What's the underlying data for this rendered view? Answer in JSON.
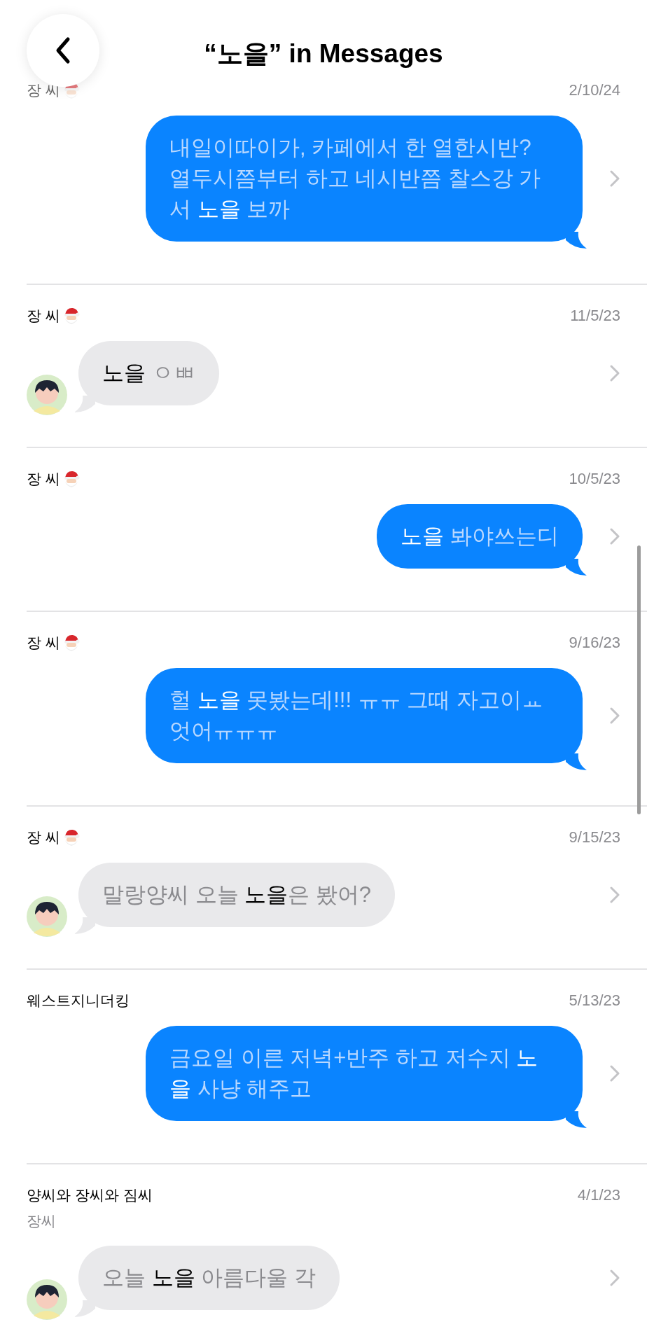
{
  "header": {
    "title": "“노을” in Messages"
  },
  "messages": [
    {
      "sender": "장 씨",
      "badge": true,
      "date": "2/10/24",
      "kind": "outgoing",
      "text": "내일이따이가, 카페에서 한 열한시반? 열두시쯤부터 하고 네시반쯤 찰스강 가서 **노을** 보까"
    },
    {
      "sender": "장 씨",
      "badge": true,
      "date": "11/5/23",
      "kind": "incoming",
      "text": "**노을** ㅇㅃ"
    },
    {
      "sender": "장 씨",
      "badge": true,
      "date": "10/5/23",
      "kind": "outgoing",
      "text": "**노을** 봐야쓰는디"
    },
    {
      "sender": "장 씨",
      "badge": true,
      "date": "9/16/23",
      "kind": "outgoing",
      "text": "헐 **노을** 못봤는데!!! ㅠㅠ 그때 자고이ㅛ엇어ㅠㅠㅠ"
    },
    {
      "sender": "장 씨",
      "badge": true,
      "date": "9/15/23",
      "kind": "incoming",
      "text": "말랑양씨 오늘 **노을**은 봤어?"
    },
    {
      "sender": "웨스트지니더킹",
      "badge": false,
      "date": "5/13/23",
      "kind": "outgoing",
      "text": "금요일 이른 저녁+반주 하고 저수지 **노을** 사냥 해주고"
    },
    {
      "sender": "양씨와 장씨와 짐씨",
      "badge": false,
      "subsender": "장씨",
      "date": "4/1/23",
      "kind": "incoming",
      "text": "오늘 **노을** 아름다울 각"
    }
  ]
}
